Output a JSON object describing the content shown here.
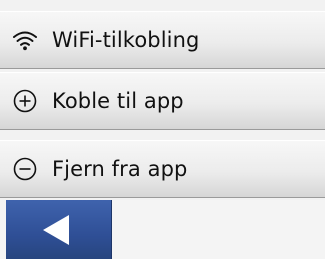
{
  "menu": {
    "items": [
      {
        "label": "WiFi-tilkobling",
        "icon": "wifi-icon"
      },
      {
        "label": "Koble til app",
        "icon": "plus-circle-icon"
      },
      {
        "label": "Fjern fra app",
        "icon": "minus-circle-icon"
      }
    ]
  },
  "navigation": {
    "back_icon": "back-arrow-icon"
  },
  "colors": {
    "back_button": "#2f4f96",
    "menu_background": "#ececec",
    "text": "#111111"
  }
}
